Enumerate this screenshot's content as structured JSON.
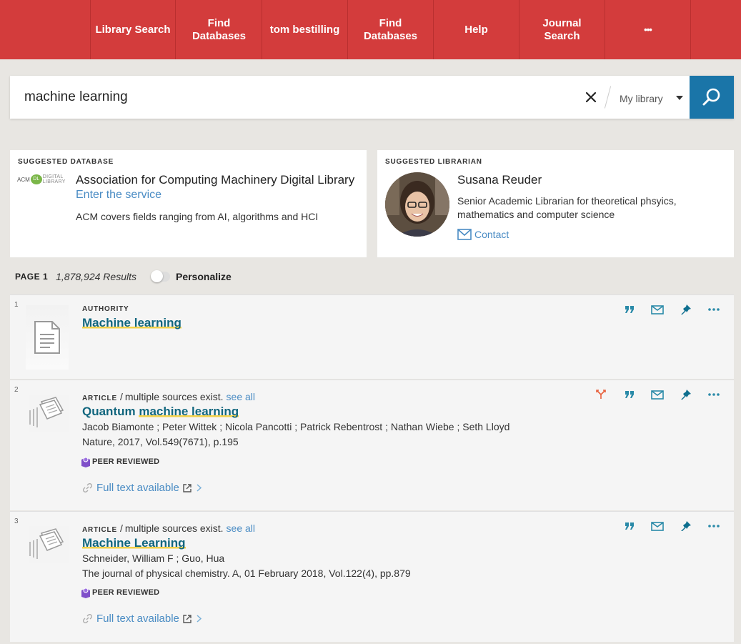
{
  "nav": {
    "items": [
      {
        "label": "Library Search"
      },
      {
        "label": "Find Databases"
      },
      {
        "label": "tom bestilling"
      },
      {
        "label": "Find Databases"
      },
      {
        "label": "Help"
      },
      {
        "label": "Journal Search"
      },
      {
        "label": "•••"
      }
    ]
  },
  "search": {
    "query": "machine learning",
    "scope": "My library"
  },
  "suggested_database": {
    "label": "SUGGESTED DATABASE",
    "logo_left": "ACM",
    "logo_mid": "DL",
    "logo_top": "DIGITAL",
    "logo_bottom": "LIBRARY",
    "title": "Association for Computing Machinery Digital Library",
    "link": "Enter the service",
    "description": "ACM covers fields ranging from AI, algorithms and HCI"
  },
  "suggested_librarian": {
    "label": "SUGGESTED LIBRARIAN",
    "name": "Susana Reuder",
    "description": "Senior Academic Librarian for theoretical phsyics, mathematics and computer science",
    "contact": "Contact"
  },
  "results_bar": {
    "page": "PAGE 1",
    "count": "1,878,924 Results",
    "personalize": "Personalize"
  },
  "results": [
    {
      "index": "1",
      "type": "AUTHORITY",
      "title": "Machine learning"
    },
    {
      "index": "2",
      "type": "ARTICLE",
      "sep": "/",
      "multi": "multiple sources exist.",
      "see_all": "see all",
      "title_plain": "Quantum ",
      "title_hl": "machine learning",
      "authors": "Jacob Biamonte ; Peter Wittek ; Nicola Pancotti ; Patrick Rebentrost ; Nathan Wiebe ; Seth Lloyd",
      "source": "Nature, 2017, Vol.549(7671), p.195",
      "peer": "PEER REVIEWED",
      "fulltext": "Full text available"
    },
    {
      "index": "3",
      "type": "ARTICLE",
      "sep": "/",
      "multi": "multiple sources exist.",
      "see_all": "see all",
      "title_hl": "Machine Learning",
      "authors": "Schneider, William F ; Guo, Hua",
      "source": "The journal of physical chemistry. A, 01 February 2018, Vol.122(4), pp.879",
      "peer": "PEER REVIEWED",
      "fulltext": "Full text available"
    }
  ],
  "icons": {
    "cite": "quote-icon",
    "email": "envelope-icon",
    "pin": "pin-icon",
    "more": "ellipsis-icon",
    "versions": "versions-icon"
  },
  "colors": {
    "nav": "#d33c3c",
    "search_button": "#1a75a8",
    "link": "#4a8cc4",
    "title": "#11667e",
    "action_icon": "#2a8aa8",
    "highlight": "#f2d14a",
    "peer_badge": "#7f4fc9",
    "versions_icon": "#e8603c"
  }
}
